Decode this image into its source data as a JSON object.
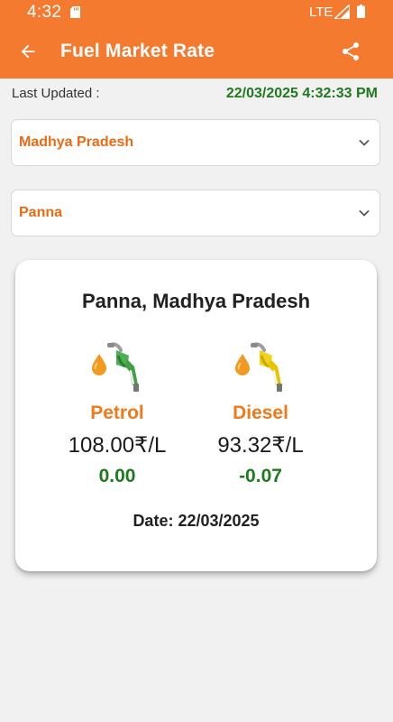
{
  "status_bar": {
    "time": "4:32",
    "network": "LTE"
  },
  "app_bar": {
    "title": "Fuel Market Rate",
    "background_color": "#f47a2f",
    "back_icon": "arrow-left-icon",
    "share_icon": "share-icon"
  },
  "last_updated": {
    "label": "Last Updated :",
    "value": "22/03/2025 4:32:33 PM"
  },
  "state_dropdown": {
    "selected": "Madhya Pradesh"
  },
  "city_dropdown": {
    "selected": "Panna"
  },
  "rate_card": {
    "location": "Panna, Madhya Pradesh",
    "petrol": {
      "name": "Petrol",
      "price": "108.00₹/L",
      "change": "0.00",
      "icon": "petrol-pump-icon",
      "color": "#4caf50"
    },
    "diesel": {
      "name": "Diesel",
      "price": "93.32₹/L",
      "change": "-0.07",
      "icon": "diesel-pump-icon",
      "color": "#f2d21b"
    },
    "date": "Date: 22/03/2025"
  },
  "colors": {
    "accent": "#f47a2f",
    "label_orange": "#ea6b14",
    "change_green": "#1f7a1f"
  }
}
